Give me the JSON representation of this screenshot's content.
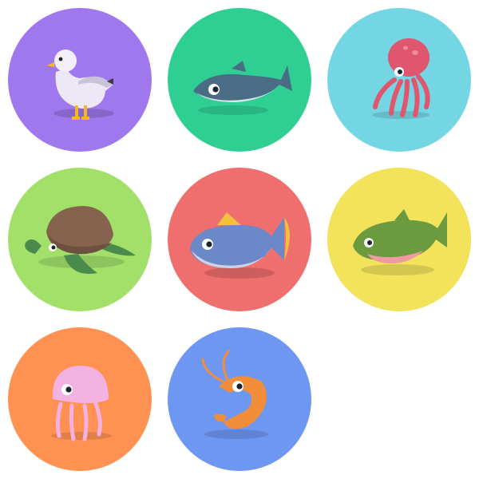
{
  "icons": [
    {
      "name": "seagull-icon",
      "bg": "#9f78ee"
    },
    {
      "name": "sardine-icon",
      "bg": "#2fcf93"
    },
    {
      "name": "octopus-icon",
      "bg": "#74d6e3"
    },
    {
      "name": "sea-turtle-icon",
      "bg": "#a2e06a"
    },
    {
      "name": "tuna-icon",
      "bg": "#ef6e6e"
    },
    {
      "name": "trout-icon",
      "bg": "#f2e35b"
    },
    {
      "name": "jellyfish-icon",
      "bg": "#ff9152"
    },
    {
      "name": "shrimp-icon",
      "bg": "#6e97f2"
    }
  ]
}
